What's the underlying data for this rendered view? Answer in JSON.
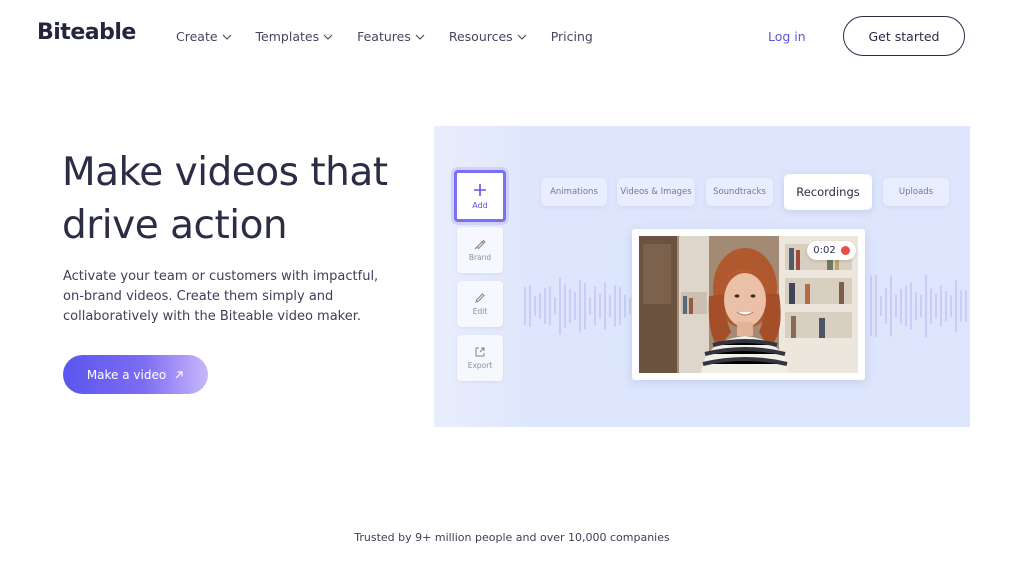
{
  "header": {
    "logo": "Biteable",
    "nav": [
      {
        "label": "Create",
        "has_dropdown": true
      },
      {
        "label": "Templates",
        "has_dropdown": true
      },
      {
        "label": "Features",
        "has_dropdown": true
      },
      {
        "label": "Resources",
        "has_dropdown": true
      },
      {
        "label": "Pricing",
        "has_dropdown": false
      }
    ],
    "login": "Log in",
    "get_started": "Get started"
  },
  "hero": {
    "title": "Make videos that drive action",
    "description": "Activate your team or customers with impactful, on-brand videos. Create them simply and collaboratively with the Biteable video maker.",
    "cta": "Make a video"
  },
  "editor": {
    "tools": [
      {
        "label": "Add",
        "icon": "plus-icon"
      },
      {
        "label": "Brand",
        "icon": "brush-icon"
      },
      {
        "label": "Edit",
        "icon": "pencil-icon"
      },
      {
        "label": "Export",
        "icon": "export-icon"
      }
    ],
    "tabs": [
      {
        "label": "Animations",
        "active": false
      },
      {
        "label": "Videos & Images",
        "active": false
      },
      {
        "label": "Soundtracks",
        "active": false
      },
      {
        "label": "Recordings",
        "active": true
      },
      {
        "label": "Uploads",
        "active": false
      }
    ],
    "timer": "0:02"
  },
  "trusted": "Trusted by 9+ million people and over 10,000 companies",
  "colors": {
    "accent": "#5b57e0",
    "text_dark": "#2a2d45",
    "panel_bg": "#dde6fc",
    "record_red": "#ea4f45"
  }
}
